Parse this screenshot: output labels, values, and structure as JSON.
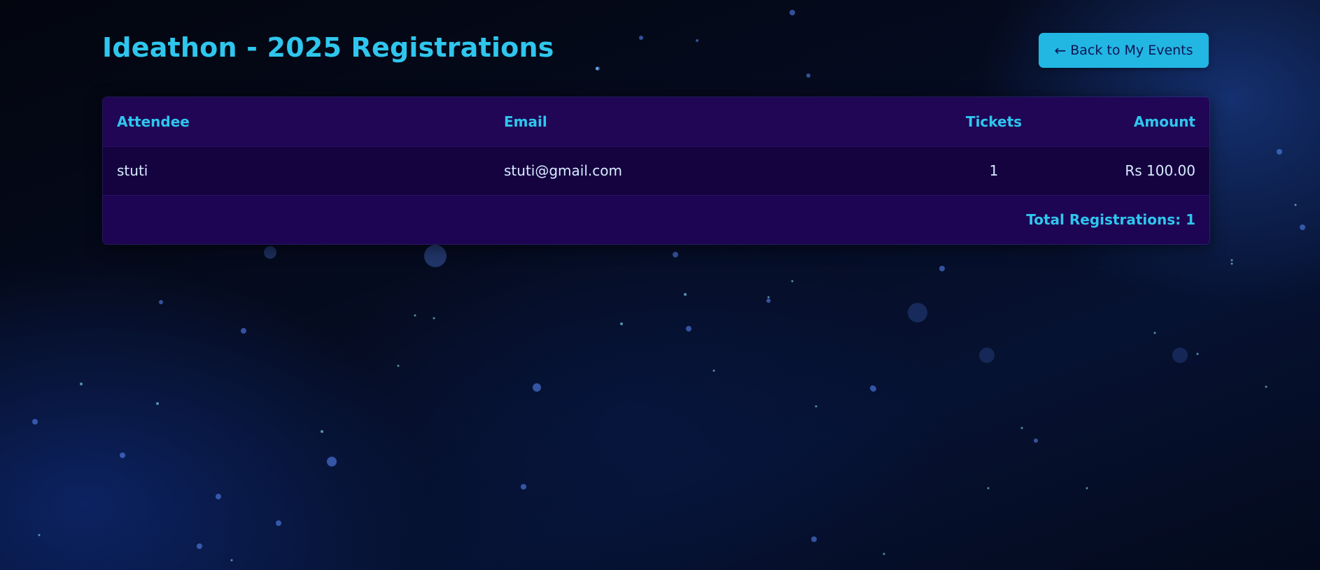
{
  "page": {
    "title": "Ideathon - 2025 Registrations",
    "back_button": {
      "icon": "left-arrow-icon",
      "arrow": "←",
      "label": "Back to My Events"
    }
  },
  "table": {
    "columns": [
      "Attendee",
      "Email",
      "Tickets",
      "Amount"
    ],
    "rows": [
      {
        "attendee": "stuti",
        "email": "stuti@gmail.com",
        "tickets": "1",
        "amount": "Rs 100.00"
      }
    ],
    "footer": "Total Registrations: 1"
  },
  "colors": {
    "accent": "#2fc6ee",
    "button_bg": "#22b6e3",
    "header_bg": "#200655",
    "row_bg": "#150340",
    "background": "#050b1f"
  }
}
